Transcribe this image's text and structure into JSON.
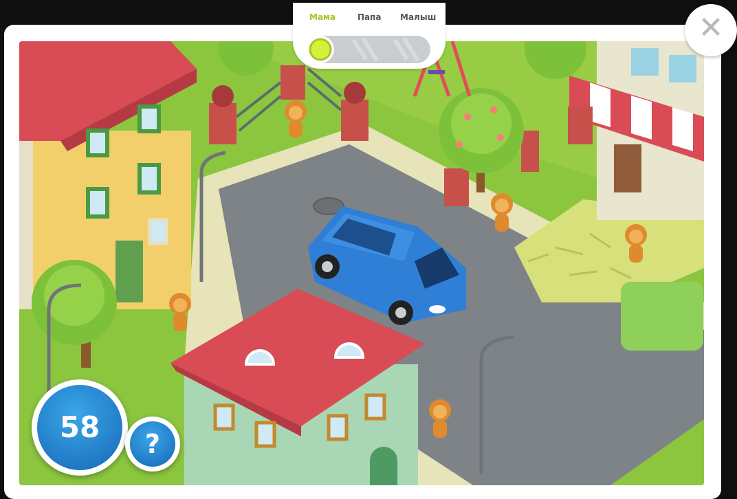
{
  "tabs": {
    "items": [
      {
        "label": "Мама",
        "active": true
      },
      {
        "label": "Папа",
        "active": false
      },
      {
        "label": "Малыш",
        "active": false
      }
    ]
  },
  "hud": {
    "counter": "58",
    "help_label": "?",
    "close_icon": "close-icon"
  },
  "colors": {
    "accent": "#a7c32a",
    "hud_blue": "#1f7fd0",
    "grass": "#8cc63f",
    "road": "#7e8387",
    "car": "#2f7fd6",
    "roof": "#d94b55"
  }
}
